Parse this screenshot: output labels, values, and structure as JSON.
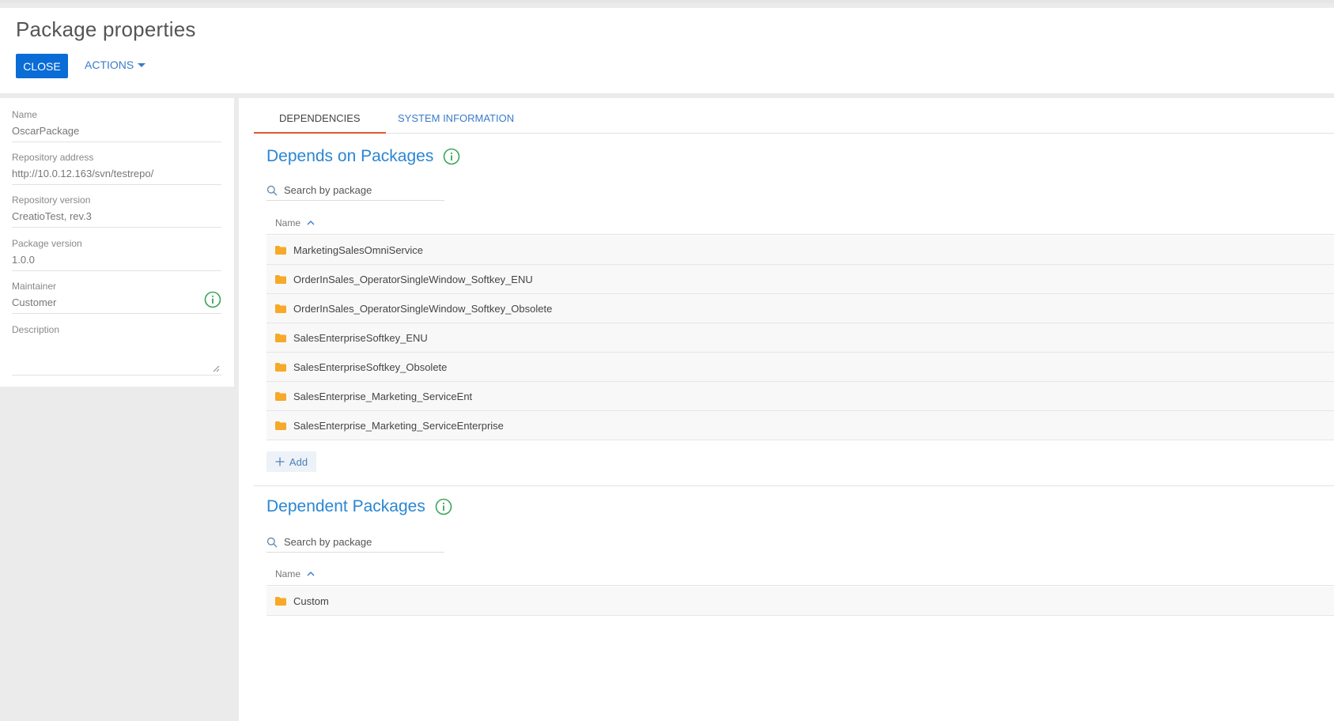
{
  "header": {
    "title": "Package properties",
    "close_label": "CLOSE",
    "actions_label": "ACTIONS"
  },
  "properties": {
    "name": {
      "label": "Name",
      "value": "OscarPackage"
    },
    "repo_address": {
      "label": "Repository address",
      "value": "http://10.0.12.163/svn/testrepo/"
    },
    "repo_version": {
      "label": "Repository version",
      "value": "CreatioTest, rev.3"
    },
    "package_version": {
      "label": "Package version",
      "value": "1.0.0"
    },
    "maintainer": {
      "label": "Maintainer",
      "value": "Customer"
    },
    "description": {
      "label": "Description",
      "value": ""
    }
  },
  "tabs": [
    {
      "label": "DEPENDENCIES",
      "active": true
    },
    {
      "label": "SYSTEM INFORMATION",
      "active": false
    }
  ],
  "depends_on": {
    "title": "Depends on Packages",
    "search_placeholder": "Search by package",
    "column": "Name",
    "rows": [
      "MarketingSalesOmniService",
      "OrderInSales_OperatorSingleWindow_Softkey_ENU",
      "OrderInSales_OperatorSingleWindow_Softkey_Obsolete",
      "SalesEnterpriseSoftkey_ENU",
      "SalesEnterpriseSoftkey_Obsolete",
      "SalesEnterprise_Marketing_ServiceEnt",
      "SalesEnterprise_Marketing_ServiceEnterprise"
    ],
    "add_label": "Add"
  },
  "dependent": {
    "title": "Dependent Packages",
    "search_placeholder": "Search by package",
    "column": "Name",
    "rows": [
      "Custom"
    ]
  },
  "colors": {
    "primary": "#0a6cd6",
    "link": "#3b7bc8",
    "section_title": "#2a86d3",
    "active_tab": "#e05a2b",
    "info": "#3aa655",
    "folder": "#f7a928"
  },
  "icons": [
    "info-icon",
    "search-icon",
    "sort-asc-icon",
    "folder-icon",
    "plus-icon",
    "caret-down-icon",
    "resize-handle-icon"
  ]
}
